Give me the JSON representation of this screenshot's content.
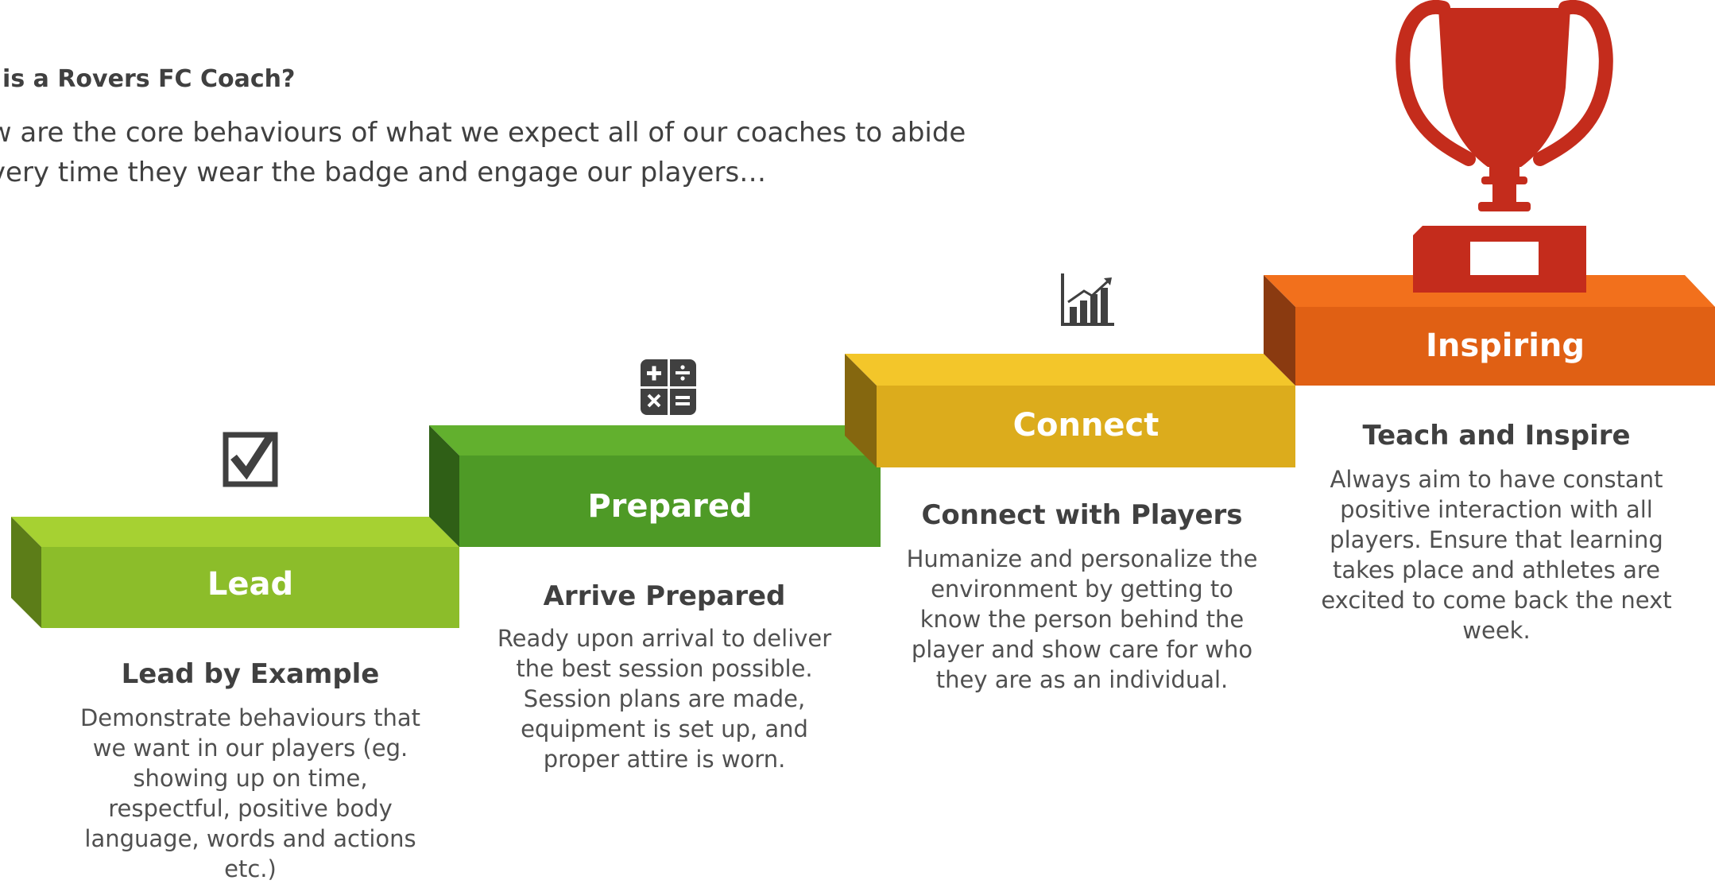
{
  "intro": {
    "heading": "o is a Rovers FC Coach?",
    "lines": [
      "ow are the core behaviours of what we expect all of our coaches to abide",
      "every time they wear the badge and engage our players…"
    ]
  },
  "steps": [
    {
      "label": "Lead",
      "title": "Lead by Example",
      "icon": "checkbox-icon",
      "color": "#8cbd2a",
      "description_lines": [
        "Demonstrate behaviours that",
        "we want in our players (eg.",
        "showing up on time,",
        "respectful, positive body",
        "language, words and actions",
        "etc.)"
      ]
    },
    {
      "label": "Prepared",
      "title": "Arrive Prepared",
      "icon": "calculator-icon",
      "color": "#4e9a26",
      "description_lines": [
        "Ready upon arrival to deliver",
        "the best session possible.",
        "Session plans are made,",
        "equipment is set up, and",
        "proper attire is worn."
      ]
    },
    {
      "label": "Connect",
      "title": "Connect with Players",
      "icon": "bar-chart-icon",
      "color": "#dcac1c",
      "description_lines": [
        "Humanize and personalize the",
        "environment by getting to",
        "know the person behind the",
        "player and show care for who",
        "they are as an individual."
      ]
    },
    {
      "label": "Inspiring",
      "title": "Teach and Inspire",
      "icon": "trophy-icon",
      "color": "#e06014",
      "description_lines": [
        "Always aim to have constant",
        "positive interaction with all",
        "players. Ensure that learning",
        "takes place and athletes are",
        "excited to come back the next",
        "week."
      ]
    }
  ]
}
